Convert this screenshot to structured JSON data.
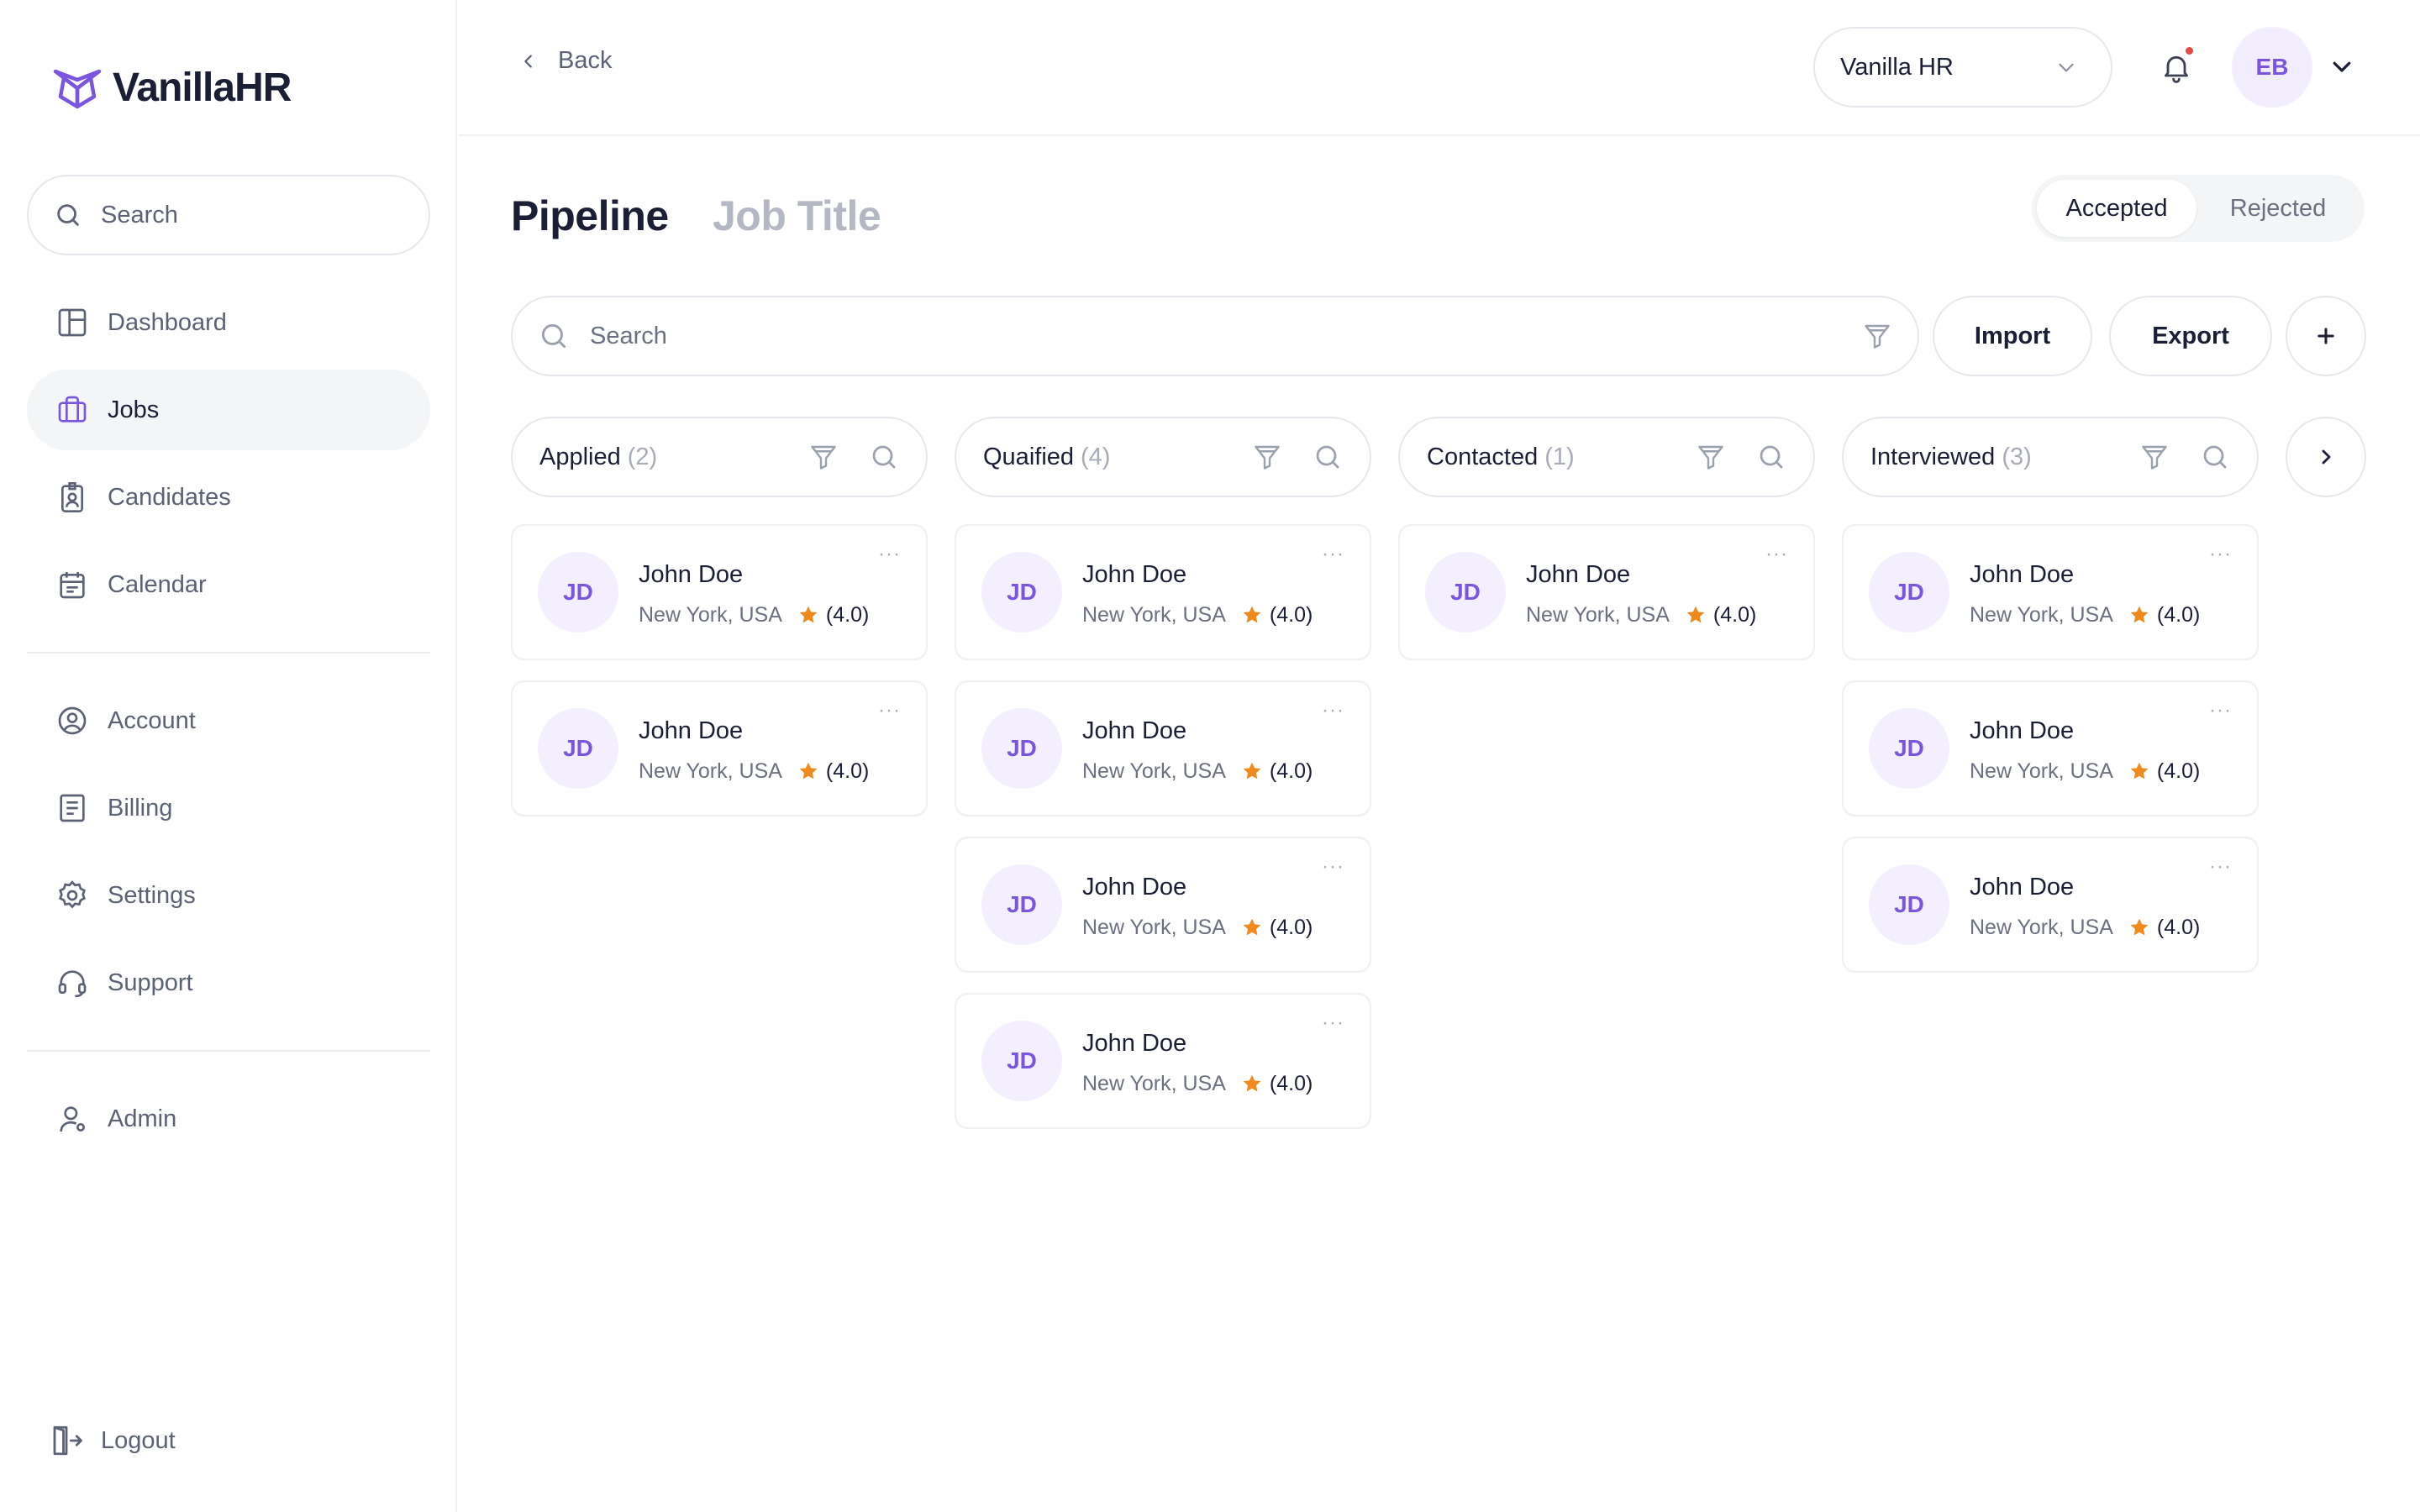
{
  "app": {
    "logo_text": "VanillaHR",
    "brand_color": "#7b55e0",
    "accent_bg": "#f3effe",
    "star_color": "#f08a1c"
  },
  "sidebar": {
    "search_placeholder": "Search",
    "primary_items": [
      {
        "label": "Dashboard",
        "icon": "dashboard-icon"
      },
      {
        "label": "Jobs",
        "icon": "briefcase-icon",
        "active": true
      },
      {
        "label": "Candidates",
        "icon": "id-badge-icon"
      },
      {
        "label": "Calendar",
        "icon": "calendar-icon"
      }
    ],
    "secondary_items": [
      {
        "label": "Account",
        "icon": "user-circle-icon"
      },
      {
        "label": "Billing",
        "icon": "receipt-icon"
      },
      {
        "label": "Settings",
        "icon": "gear-icon"
      },
      {
        "label": "Support",
        "icon": "headset-icon"
      }
    ],
    "admin_item": {
      "label": "Admin",
      "icon": "user-icon"
    },
    "logout_label": "Logout"
  },
  "topbar": {
    "back_label": "Back",
    "org_select": "Vanilla HR",
    "avatar_initials": "EB"
  },
  "page": {
    "title": "Pipeline",
    "subtitle": "Job Title",
    "segments": [
      "Accepted",
      "Rejected"
    ],
    "active_segment": "Accepted",
    "search_placeholder": "Search",
    "import_label": "Import",
    "export_label": "Export"
  },
  "columns": [
    {
      "name": "Applied",
      "count": "(2)",
      "cards": [
        {
          "initials": "JD",
          "name": "John Doe",
          "location": "New York, USA",
          "rating": "(4.0)"
        },
        {
          "initials": "JD",
          "name": "John Doe",
          "location": "New York, USA",
          "rating": "(4.0)"
        }
      ]
    },
    {
      "name": "Quaified",
      "count": "(4)",
      "cards": [
        {
          "initials": "JD",
          "name": "John Doe",
          "location": "New York, USA",
          "rating": "(4.0)"
        },
        {
          "initials": "JD",
          "name": "John Doe",
          "location": "New York, USA",
          "rating": "(4.0)"
        },
        {
          "initials": "JD",
          "name": "John Doe",
          "location": "New York, USA",
          "rating": "(4.0)"
        },
        {
          "initials": "JD",
          "name": "John Doe",
          "location": "New York, USA",
          "rating": "(4.0)"
        }
      ]
    },
    {
      "name": "Contacted",
      "count": "(1)",
      "cards": [
        {
          "initials": "JD",
          "name": "John Doe",
          "location": "New York, USA",
          "rating": "(4.0)"
        }
      ]
    },
    {
      "name": "Interviewed",
      "count": "(3)",
      "cards": [
        {
          "initials": "JD",
          "name": "John Doe",
          "location": "New York, USA",
          "rating": "(4.0)"
        },
        {
          "initials": "JD",
          "name": "John Doe",
          "location": "New York, USA",
          "rating": "(4.0)"
        },
        {
          "initials": "JD",
          "name": "John Doe",
          "location": "New York, USA",
          "rating": "(4.0)"
        }
      ]
    }
  ]
}
